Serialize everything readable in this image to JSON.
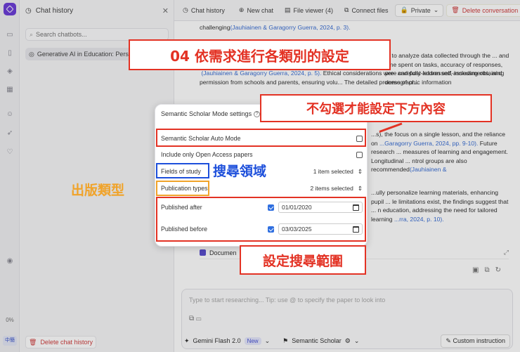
{
  "sidebar": {
    "title": "Chat history",
    "search_placeholder": "Search chatbots...",
    "chat_items": [
      "Generative AI in Education: Personalized"
    ],
    "delete_label": "Delete chat history"
  },
  "rail": {
    "usage_pct": "0%",
    "lang": "中簡"
  },
  "toolbar": {
    "chat_history": "Chat history",
    "new_chat": "New chat",
    "file_viewer": "File viewer (4)",
    "connect_files": "Connect files",
    "private": "Private",
    "delete_conversation": "Delete conversation"
  },
  "content": {
    "p1": "challenging",
    "p1_cite": "(Jauhiainen & Garagorry Guerra, 2024, p. 3).",
    "p2": "... to analyze data collected through the ... and time spent on tasks, accuracy of responses, pre- and post-lesson self-assessments, and demographic information",
    "p2_cite": "(Jauhiainen & Garagorry Guerra, 2024, p. 5).",
    "p2b": " Ethical considerations were carefully addressed, including obtaining permission from schools and parents, ensuring volu...",
    "p2c": "The detailed process of cr...",
    "p3": "...s), the focus on a single lesson, and the reliance on",
    "p3_cite": "...Garagorry Guerra, 2024, pp. 9-10).",
    "p3b": " Future research ... measures of learning and engagement. Longitudinal ... ntrol groups are also recommended",
    "p3_cite2": "(Jauhiainen &",
    "p4": "...ully personalize learning materials, enhancing pupil ... le limitations exist, the findings suggest that ... n education, addressing the need for tailored learning",
    "p4_cite": "...rra, 2024, p. 10).",
    "doc_chip": "Documen"
  },
  "prompt": {
    "placeholder": "Type to start researching... Tip: use @ to specify the paper to look into"
  },
  "bottom": {
    "model": "Gemini Flash 2.0",
    "new_badge": "New",
    "mode": "Semantic Scholar",
    "custom": "Custom instruction"
  },
  "popup": {
    "title": "Semantic Scholar Mode settings",
    "auto_mode": "Semantic Scholar Auto Mode",
    "open_access": "Include only Open Access papers",
    "fields_label": "Fields of study",
    "fields_value": "1 item selected",
    "pub_label": "Publication types",
    "pub_value": "2 items selected",
    "after_label": "Published after",
    "after_value": "01/01/2020",
    "before_label": "Published before",
    "before_value": "03/03/2025"
  },
  "annotations": {
    "step_banner": "04 依需求進行各類別的設定",
    "uncheck_note": "不勾選才能設定下方內容",
    "fields_note": "搜尋領域",
    "pub_note": "出版類型",
    "range_note": "設定搜尋範圍"
  },
  "colors": {
    "accent": "#6d3fd8",
    "annotation_red": "#e33224",
    "annotation_blue": "#1d4fdb",
    "annotation_orange": "#f0a32a",
    "link": "#3b6fd4"
  }
}
